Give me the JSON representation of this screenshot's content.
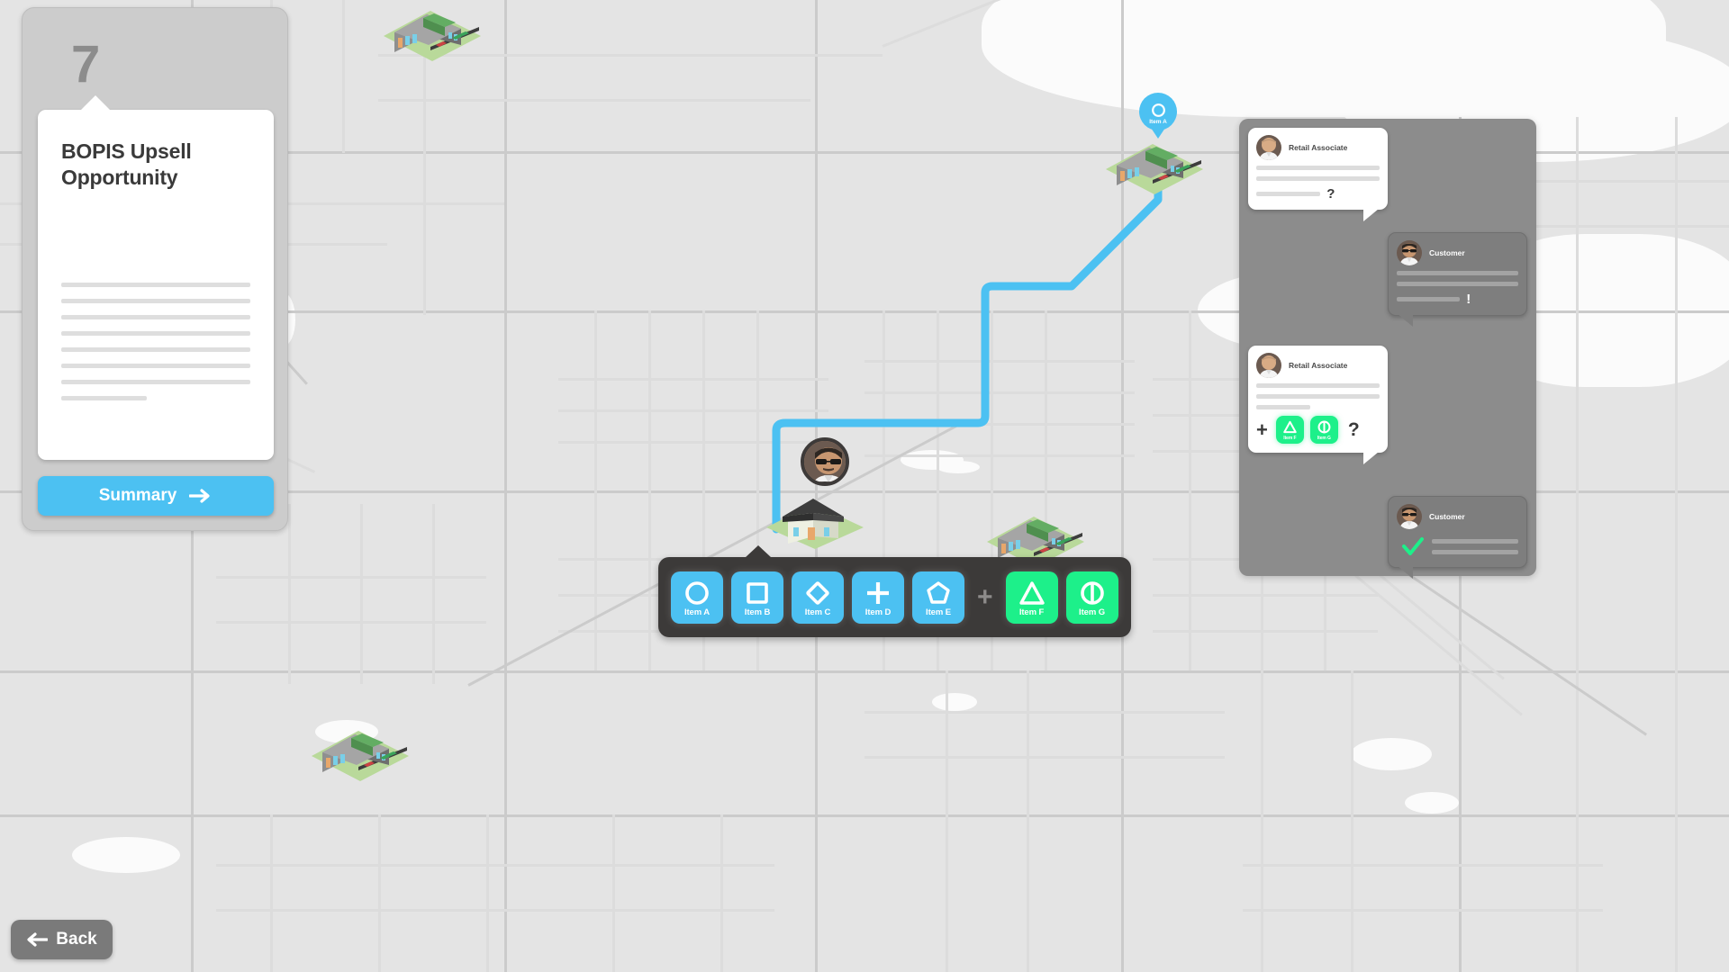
{
  "step": {
    "number": "7",
    "title": "BOPIS Upsell Opportunity",
    "body_line_count": 8,
    "summary_label": "Summary",
    "summary_icon": "arrow-right-icon",
    "accent_color": "#4cc1f2",
    "panel_color": "#cccccc"
  },
  "back": {
    "label": "Back",
    "icon": "arrow-left-icon"
  },
  "toolbar": {
    "separator": "+",
    "items": [
      {
        "label": "Item A",
        "glyph": "circle-icon",
        "color": "#4cc1f2",
        "group": "blue"
      },
      {
        "label": "Item B",
        "glyph": "square-icon",
        "color": "#4cc1f2",
        "group": "blue"
      },
      {
        "label": "Item C",
        "glyph": "diamond-icon",
        "color": "#4cc1f2",
        "group": "blue"
      },
      {
        "label": "Item D",
        "glyph": "plus-icon",
        "color": "#4cc1f2",
        "group": "blue"
      },
      {
        "label": "Item E",
        "glyph": "pentagon-icon",
        "color": "#4cc1f2",
        "group": "blue"
      },
      {
        "label": "Item F",
        "glyph": "triangle-icon",
        "color": "#1df08a",
        "group": "green"
      },
      {
        "label": "Item G",
        "glyph": "circle-split-icon",
        "color": "#1df08a",
        "group": "green"
      }
    ]
  },
  "map": {
    "pin": {
      "label": "Item A",
      "glyph": "circle-icon",
      "color": "#4cc1f2"
    },
    "route_color": "#4cc1f2",
    "stores": [
      {
        "name": "store-marker-north"
      },
      {
        "name": "store-marker-destination"
      },
      {
        "name": "store-marker-east"
      },
      {
        "name": "store-marker-southwest"
      }
    ],
    "house": {
      "name": "customer-house"
    },
    "avatar": {
      "name": "customer-avatar-marker"
    }
  },
  "chat": {
    "messages": [
      {
        "sender": "Retail Associate",
        "side": "left",
        "lines": [
          100,
          100,
          52
        ],
        "punct": "?",
        "chips": [],
        "check": false
      },
      {
        "sender": "Customer",
        "side": "right",
        "lines": [
          100,
          100,
          52
        ],
        "punct": "!",
        "chips": [],
        "check": false
      },
      {
        "sender": "Retail Associate",
        "side": "left",
        "lines": [
          100,
          100,
          44
        ],
        "punct": "?",
        "chips": [
          {
            "label": "Item F",
            "glyph": "triangle-icon",
            "color": "#1df08a"
          },
          {
            "label": "Item G",
            "glyph": "circle-split-icon",
            "color": "#1df08a"
          }
        ],
        "chip_prefix": "+",
        "check": false
      },
      {
        "sender": "Customer",
        "side": "right",
        "lines": [
          100,
          100
        ],
        "punct": "",
        "chips": [],
        "check": true,
        "check_color": "#1df08a"
      }
    ]
  }
}
